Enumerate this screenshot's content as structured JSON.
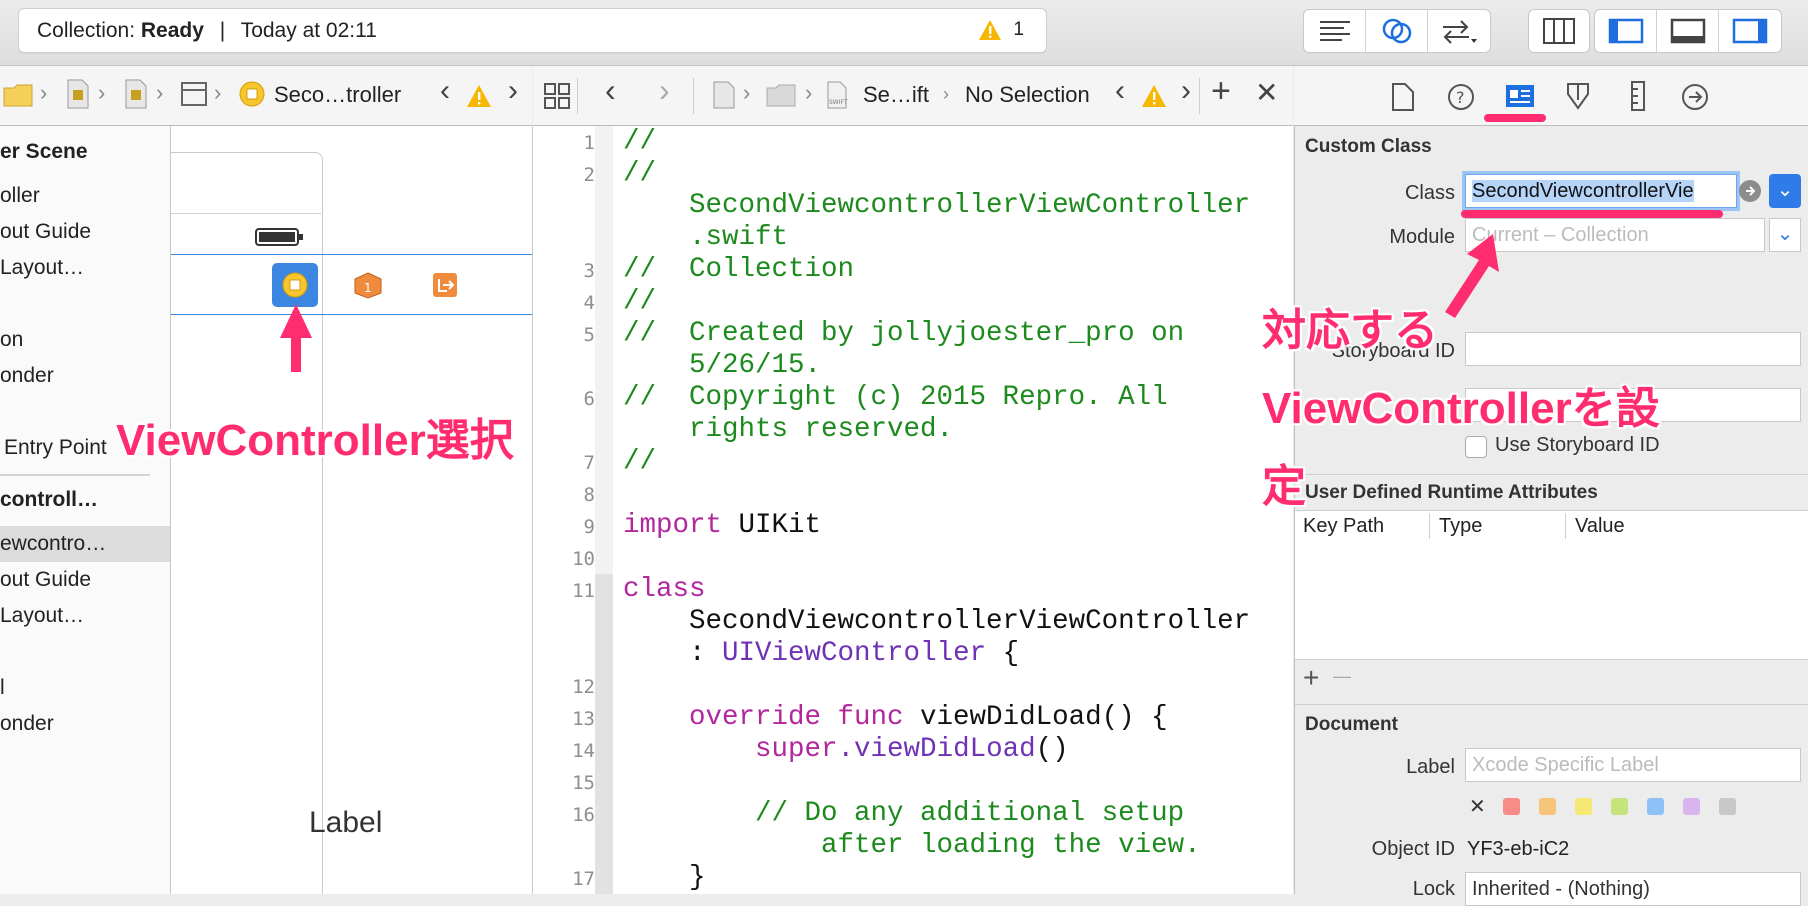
{
  "toolbar": {
    "status_prefix": "Collection: ",
    "status_bold": "Ready",
    "status_sep": "|",
    "status_time": "Today at 02:11",
    "warning_count": "1"
  },
  "jumpbar_left": {
    "crumb": "Seco…troller"
  },
  "jumpbar_mid": {
    "file_crumb": "Se…ift",
    "selection": "No Selection"
  },
  "outline": {
    "items": [
      {
        "label": "er Scene",
        "bold": true
      },
      {
        "label": "oller",
        "bold": false
      },
      {
        "label": "out Guide",
        "bold": false
      },
      {
        "label": "Layout…",
        "bold": false
      },
      {
        "label": "on",
        "bold": false
      },
      {
        "label": "onder",
        "bold": false
      },
      {
        "label": "Entry Point",
        "bold": false
      },
      {
        "label": "controll…",
        "bold": true
      },
      {
        "label": "ewcontro…",
        "bold": false
      },
      {
        "label": "out Guide",
        "bold": false
      },
      {
        "label": "Layout…",
        "bold": false
      },
      {
        "label": "l",
        "bold": false
      },
      {
        "label": "onder",
        "bold": false
      }
    ]
  },
  "canvas": {
    "label_text": "Label"
  },
  "code": {
    "line_numbers": [
      "1",
      "2",
      "3",
      "4",
      "5",
      "6",
      "7",
      "8",
      "9",
      "10",
      "11",
      "12",
      "13",
      "14",
      "15",
      "16",
      "17"
    ],
    "l1": "//",
    "l2a": "//",
    "l2b": "    SecondViewcontrollerViewController",
    "l2c": "    .swift",
    "l3": "//  Collection",
    "l4": "//",
    "l5a": "//  Created by jollyjoester_pro on",
    "l5b": "    5/26/15.",
    "l6a": "//  Copyright (c) 2015 Repro. All",
    "l6b": "    rights reserved.",
    "l7": "//",
    "l9_kw": "import",
    "l9_tx": " UIKit",
    "l11_kw": "class",
    "l11b": "    SecondViewcontrollerViewController",
    "l11c_pre": "    : ",
    "l11c_ty": "UIViewController",
    "l11c_post": " {",
    "l13_kw": "    override func",
    "l13_tx": " viewDidLoad() {",
    "l14_kw": "        super",
    "l14_ty": ".viewDidLoad",
    "l14_tx": "()",
    "l16a": "        // Do any additional setup",
    "l16b": "            after loading the view.",
    "l17": "    }"
  },
  "inspector": {
    "custom_class_header": "Custom Class",
    "class_label": "Class",
    "class_value": "SecondViewcontrollerVie",
    "module_label": "Module",
    "module_placeholder": "Current – Collection",
    "storyboard_id_label": "Storyboard ID",
    "use_storyboard_id": "Use Storyboard ID",
    "udra_header": "User Defined Runtime Attributes",
    "col_keypath": "Key Path",
    "col_type": "Type",
    "col_value": "Value",
    "add_symbol": "+",
    "remove_symbol": "—",
    "document_header": "Document",
    "label_label": "Label",
    "label_placeholder": "Xcode Specific Label",
    "object_id_label": "Object ID",
    "object_id_value": "YF3-eb-iC2",
    "lock_label": "Lock",
    "lock_value": "Inherited - (Nothing)",
    "clear_symbol": "✕",
    "label_colors": [
      "#f78b87",
      "#f7c57a",
      "#f5e873",
      "#c5e57c",
      "#8ec2f7",
      "#d8b5ec",
      "#c8c8c8"
    ]
  },
  "annotations": {
    "left_note": "ViewController選択",
    "right_note_1": "対応する",
    "right_note_2": "ViewControllerを設",
    "right_note_3": "定",
    "accent": "#ff2d6f"
  }
}
